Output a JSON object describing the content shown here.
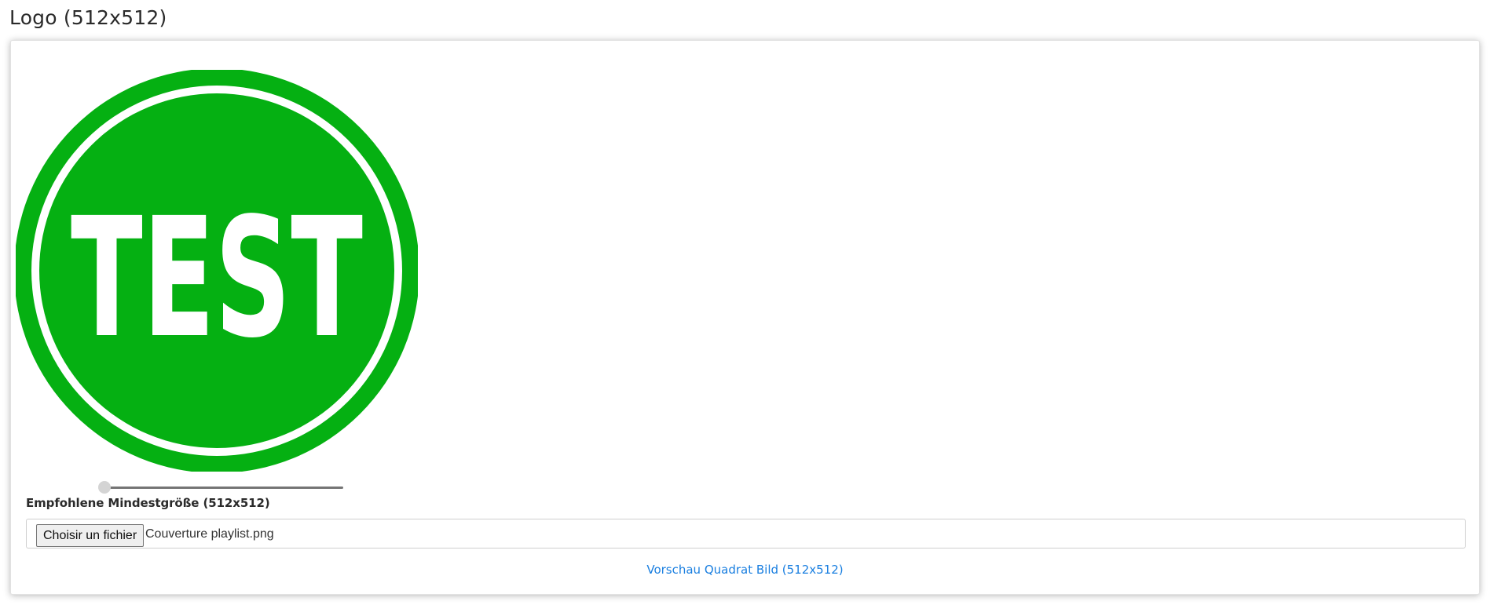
{
  "section": {
    "title": "Logo (512x512)"
  },
  "preview": {
    "logo_text": "TEST",
    "logo_color": "#05B012",
    "logo_text_color": "#FFFFFF"
  },
  "zoom": {
    "value_fraction": 0.0
  },
  "upload": {
    "size_hint": "Empfohlene Mindestgröße (512x512)",
    "button_label": "Choisir un fichier",
    "file_name": "Couverture playlist.png"
  },
  "link": {
    "preview_label": "Vorschau Quadrat Bild (512x512)",
    "color": "#1A7FE0"
  }
}
